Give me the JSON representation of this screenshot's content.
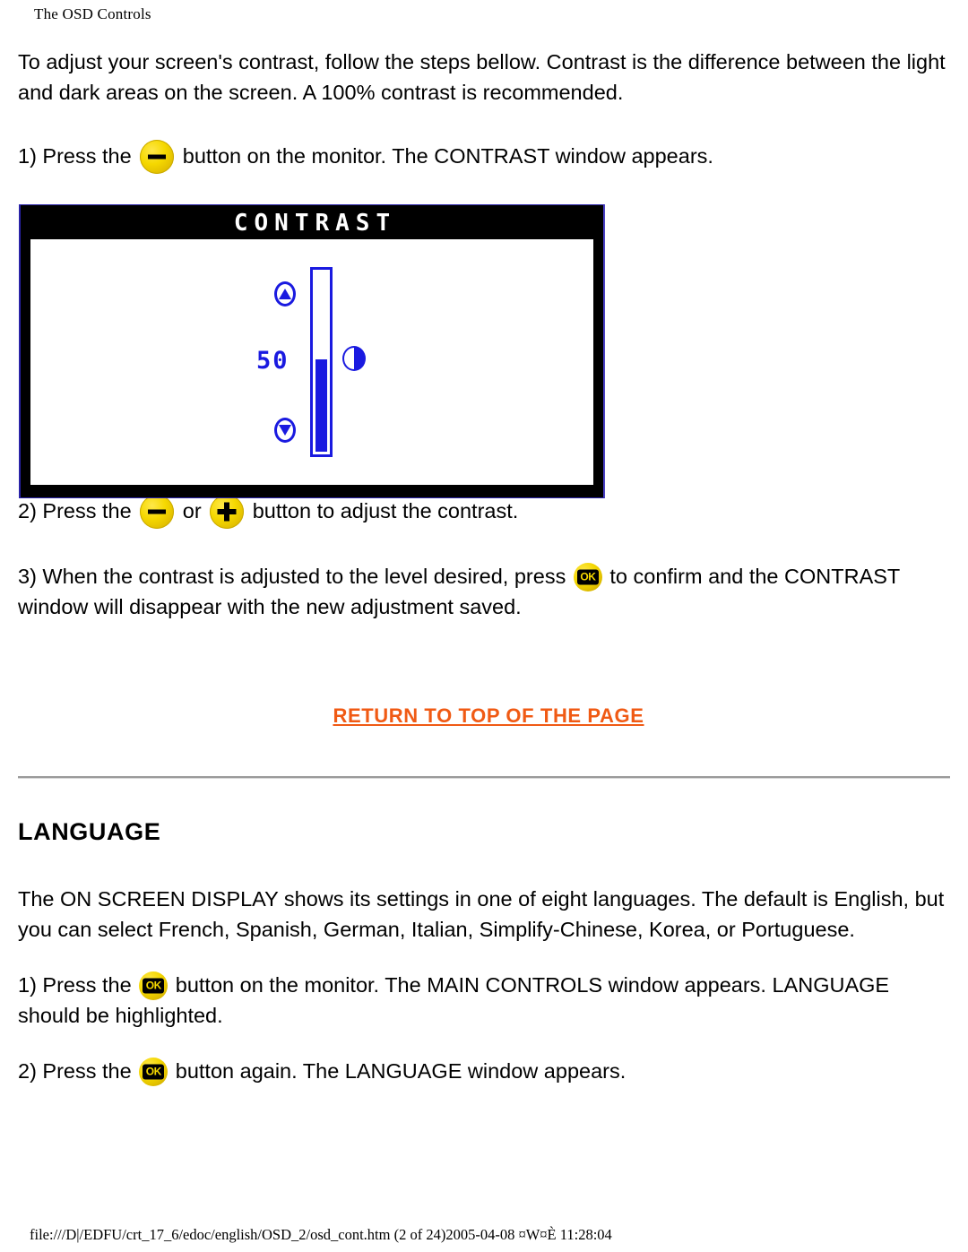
{
  "page": {
    "header": "The OSD Controls",
    "footer": "file:///D|/EDFU/crt_17_6/edoc/english/OSD_2/osd_cont.htm (2 of 24)2005-04-08 ¤W¤È 11:28:04"
  },
  "intro": {
    "paragraph": "To adjust your screen's contrast, follow the steps bellow. Contrast is the difference between the light and dark areas on the screen. A 100% contrast is recommended."
  },
  "steps": {
    "step1_before": "1) Press the",
    "step1_after": "button on the monitor. The CONTRAST window appears.",
    "step2_before": "2) Press the",
    "step2_or": "or",
    "step2_after": "button to adjust the contrast.",
    "step3_before": "3) When the contrast is adjusted to the level desired, press",
    "step3_after": "to confirm and the CONTRAST window will disappear with the new adjustment saved."
  },
  "osd": {
    "title": "CONTRAST",
    "value": "50",
    "fill_percent": 50,
    "up_arrow": "▲",
    "down_arrow": "▼",
    "accent_color": "#1a1ae0",
    "titlebar_color": "#000000",
    "border_color": "#2a23a8"
  },
  "buttons": {
    "minus_label": "−",
    "plus_label": "+",
    "ok_label": "OK",
    "button_color": "#f5d800"
  },
  "return_link": {
    "label": "RETURN TO TOP OF THE PAGE",
    "color": "#f05a14"
  },
  "language_section": {
    "heading": "LANGUAGE",
    "paragraph": "The ON SCREEN DISPLAY shows its settings in one of eight languages. The default is English, but you can select French, Spanish, German, Italian, Simplify-Chinese, Korea, or Portuguese.",
    "step1_before": "1) Press the",
    "step1_after": "button on the monitor. The MAIN CONTROLS window appears. LANGUAGE should be highlighted.",
    "step2_before": "2) Press the",
    "step2_after": "button again. The LANGUAGE window appears."
  }
}
